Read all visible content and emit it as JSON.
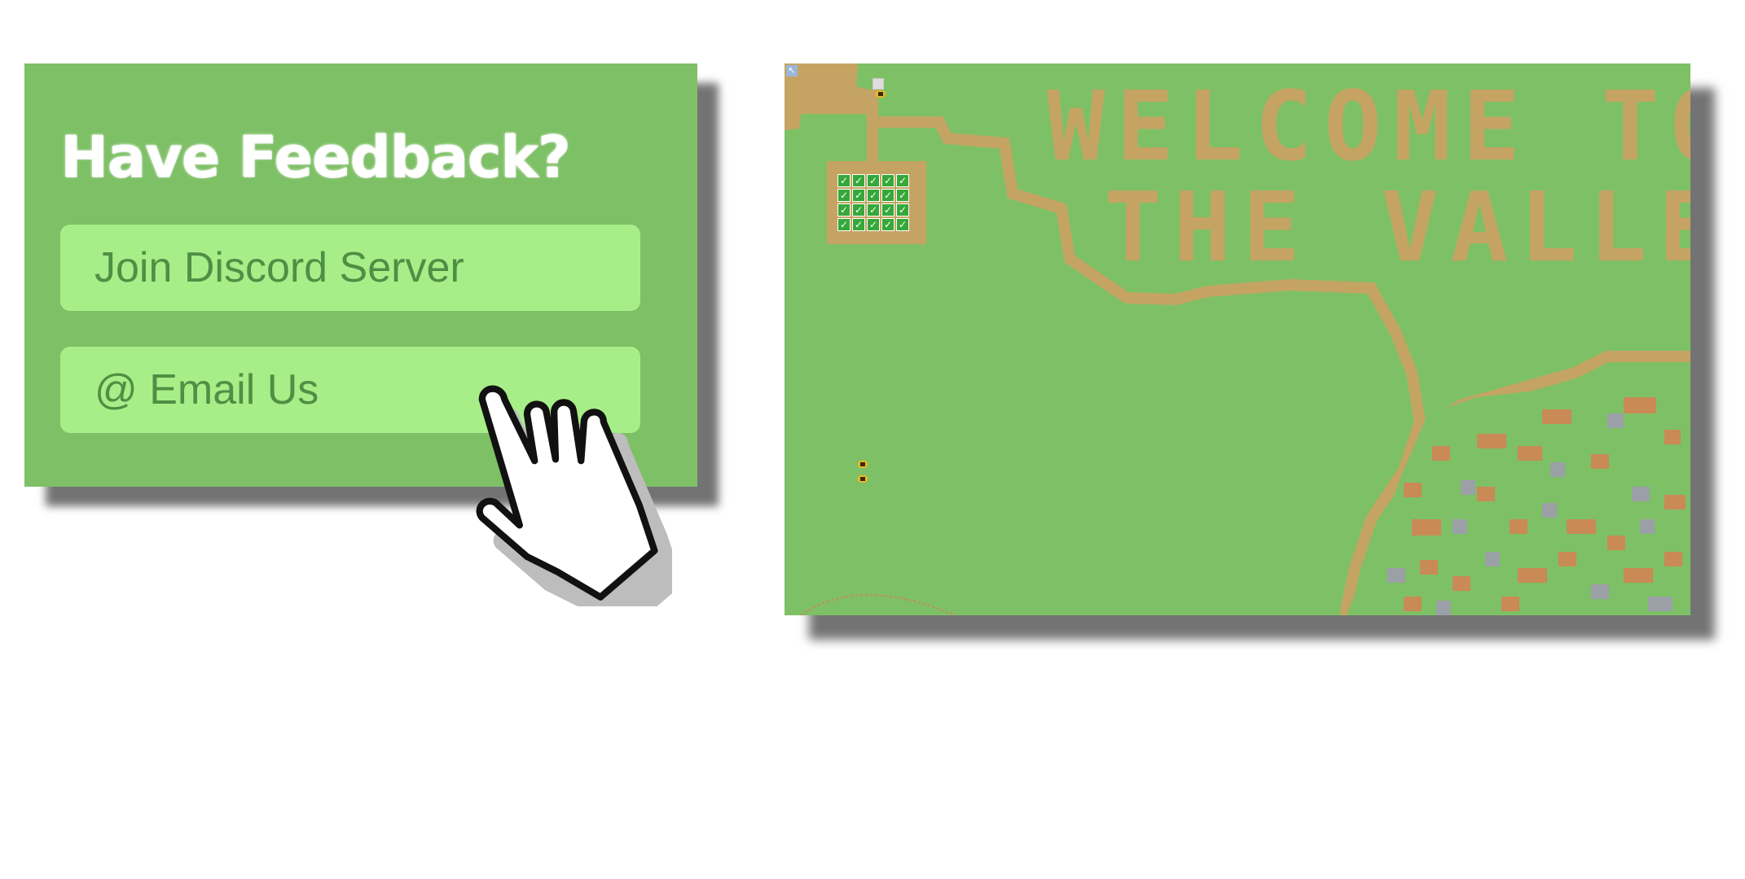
{
  "feedback": {
    "title": "Have Feedback?",
    "discord_button": "Join Discord Server",
    "email_button": "@ Email Us"
  },
  "game": {
    "banner_line1": "WELCOME TO",
    "banner_line2": "THE VALLEY",
    "crop_rows": 4,
    "crop_cols": 5,
    "crop_glyph": "✓",
    "corner_glyph": "↖"
  },
  "colors": {
    "grass": "#7ec066",
    "dirt": "#c5a463",
    "button": "#a8ee88",
    "button_text": "#4f8f44",
    "clay": "#c98a55",
    "stone": "#9aa0a6"
  },
  "icons": [
    "hand-pointer-icon",
    "crop-icon",
    "bee-icon",
    "cursor-icon"
  ]
}
